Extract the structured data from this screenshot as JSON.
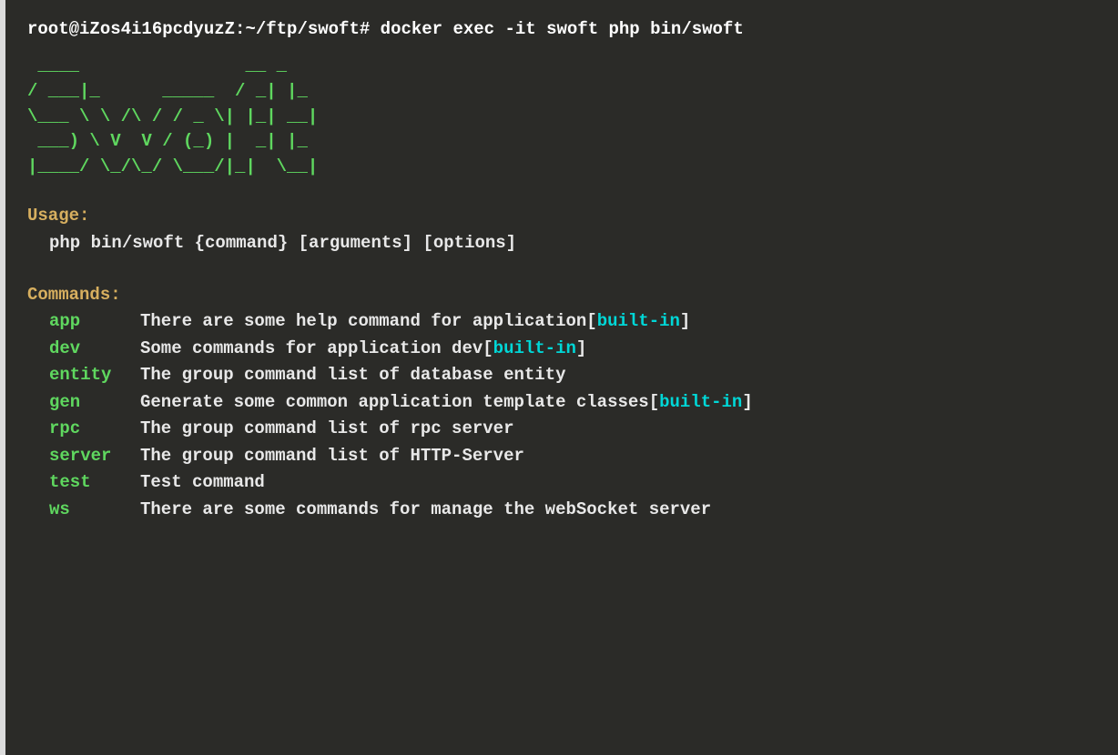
{
  "prompt": "root@iZos4i16pcdyuzZ:~/ftp/swoft# docker exec -it swoft php bin/swoft",
  "ascii_art": " ____                __ _\n/ ___|_      _____  / _| |_\n\\___ \\ \\ /\\ / / _ \\| |_| __|\n ___) \\ V  V / (_) |  _| |_\n|____/ \\_/\\_/ \\___/|_|  \\__|",
  "usage": {
    "header": "Usage:",
    "line": "php bin/swoft {command} [arguments] [options]"
  },
  "commands": {
    "header": "Commands:",
    "items": [
      {
        "name": "app",
        "desc": "There are some help command for application",
        "builtin": true
      },
      {
        "name": "dev",
        "desc": "Some commands for application dev",
        "builtin": true
      },
      {
        "name": "entity",
        "desc": "The group command list of database entity",
        "builtin": false
      },
      {
        "name": "gen",
        "desc": "Generate some common application template classes",
        "builtin": true
      },
      {
        "name": "rpc",
        "desc": "The group command list of rpc server",
        "builtin": false
      },
      {
        "name": "server",
        "desc": "The group command list of HTTP-Server",
        "builtin": false
      },
      {
        "name": "test",
        "desc": "Test command",
        "builtin": false
      },
      {
        "name": "ws",
        "desc": "There are some commands for manage the webSocket server",
        "builtin": false
      }
    ]
  },
  "builtin_label": "built-in"
}
